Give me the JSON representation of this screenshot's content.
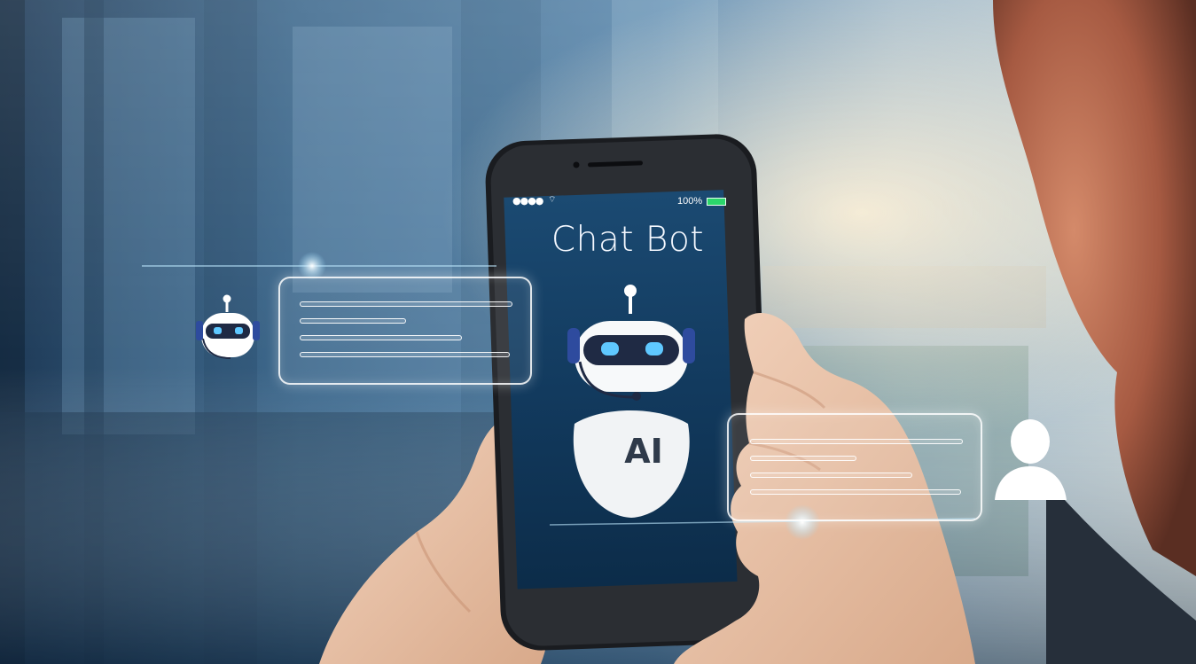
{
  "app": {
    "title": "Chat Bot",
    "badge": "AI",
    "battery": "100%",
    "signal": "●●●●"
  },
  "icons": {
    "robot": "robot-icon",
    "user": "user-icon",
    "wifi": "wifi-icon",
    "battery": "battery-icon"
  },
  "colors": {
    "screen": "#143a5e",
    "battery_fill": "#2bd66b",
    "bubble_outline": "#ffffff"
  }
}
